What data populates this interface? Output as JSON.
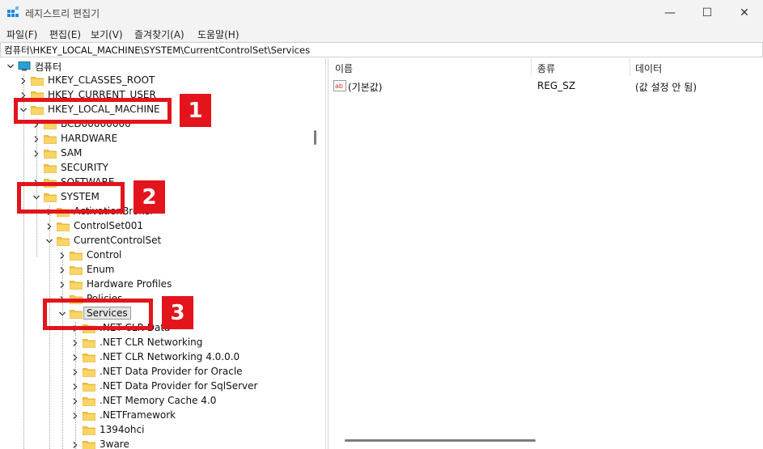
{
  "window": {
    "title": "레지스트리 편집기",
    "minimize": "—",
    "maximize": "☐",
    "close": "✕"
  },
  "menu": [
    "파일(F)",
    "편집(E)",
    "보기(V)",
    "즐겨찾기(A)",
    "도움말(H)"
  ],
  "address": "컴퓨터\\HKEY_LOCAL_MACHINE\\SYSTEM\\CurrentControlSet\\Services",
  "tree": [
    {
      "label": "컴퓨터",
      "expanded": true,
      "icon": "computer-icon"
    },
    {
      "label": "HKEY_CLASSES_ROOT",
      "expanded": false
    },
    {
      "label": "HKEY_CURRENT_USER",
      "expanded": false
    },
    {
      "label": "HKEY_LOCAL_MACHINE",
      "expanded": true
    },
    {
      "label": "BCD00000000",
      "expanded": false
    },
    {
      "label": "HARDWARE",
      "expanded": false
    },
    {
      "label": "SAM",
      "expanded": false
    },
    {
      "label": "SECURITY",
      "expanded": null
    },
    {
      "label": "SOFTWARE",
      "expanded": false
    },
    {
      "label": "SYSTEM",
      "expanded": true
    },
    {
      "label": "ActivationBroker",
      "expanded": false
    },
    {
      "label": "ControlSet001",
      "expanded": false
    },
    {
      "label": "CurrentControlSet",
      "expanded": true
    },
    {
      "label": "Control",
      "expanded": false
    },
    {
      "label": "Enum",
      "expanded": false
    },
    {
      "label": "Hardware Profiles",
      "expanded": false
    },
    {
      "label": "Policies",
      "expanded": false
    },
    {
      "label": "Services",
      "expanded": true,
      "selected": true
    },
    {
      "label": ".NET CLR Data",
      "expanded": false
    },
    {
      "label": ".NET CLR Networking",
      "expanded": false
    },
    {
      "label": ".NET CLR Networking 4.0.0.0",
      "expanded": false
    },
    {
      "label": ".NET Data Provider for Oracle",
      "expanded": false
    },
    {
      "label": ".NET Data Provider for SqlServer",
      "expanded": false
    },
    {
      "label": ".NET Memory Cache 4.0",
      "expanded": false
    },
    {
      "label": ".NETFramework",
      "expanded": false
    },
    {
      "label": "1394ohci",
      "expanded": null
    },
    {
      "label": "3ware",
      "expanded": false
    }
  ],
  "list": {
    "columns": [
      "이름",
      "종류",
      "데이터"
    ],
    "rows": [
      {
        "name": "(기본값)",
        "type": "REG_SZ",
        "data": "(값 설정 안 됨)",
        "icon": "string-value-icon"
      }
    ]
  },
  "annotations": [
    {
      "number": "1"
    },
    {
      "number": "2"
    },
    {
      "number": "3"
    }
  ],
  "colors": {
    "highlight": "#e3141b",
    "folder": "#f5c542",
    "chrome": "#f3f3f3"
  }
}
